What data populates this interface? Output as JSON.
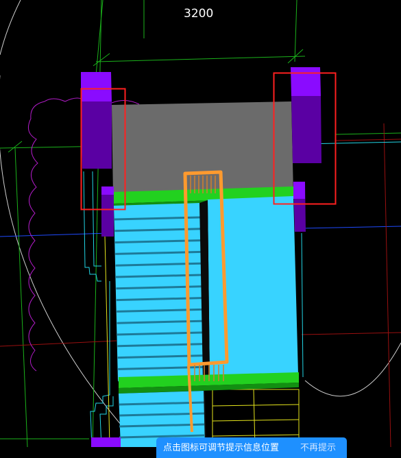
{
  "viewport": {
    "dimension_label": "3200",
    "colors": {
      "background": "#000000",
      "gray_slab": "#6b6b6b",
      "purple_column": "#5a00a3",
      "purple_column_top": "#8a0bff",
      "landing_green": "#22d11f",
      "stair_blue": "#38d3ff",
      "rail_orange": "#ff9a2e",
      "highlight_red": "#ff2020",
      "grid_green": "#1bb31b",
      "grid_cyan": "#22d6e6",
      "grid_red": "#9b1010",
      "grid_blue": "#1f4bff",
      "outline_magenta": "#b21cc9",
      "guide_white": "#cfcfcf",
      "outline_yellow": "#e6e61c"
    }
  },
  "toast": {
    "message": "点击图标可调节提示信息位置",
    "action_label": "不再提示"
  }
}
